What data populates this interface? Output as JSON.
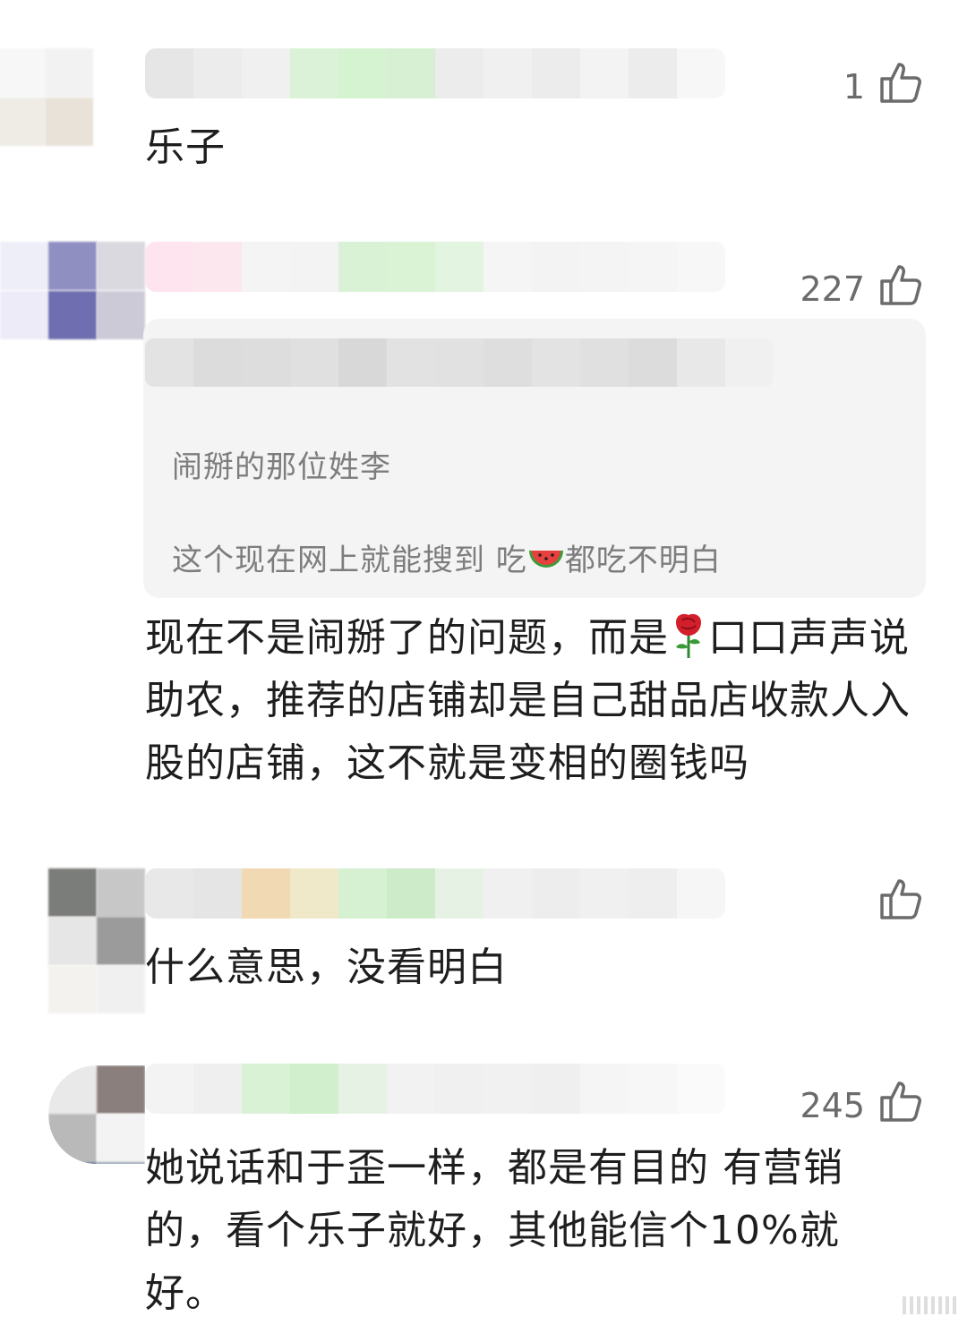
{
  "comments": [
    {
      "likes": "1",
      "text": "乐子",
      "avatar_colors": [
        "#f7f7f7",
        "#f2f2f2",
        "#efece6",
        "#e8e2d8"
      ],
      "name_colors": [
        "#e6e6e6",
        "#ececec",
        "#f0f0f0",
        "#dbf2d8",
        "#d5f3d1",
        "#d7f0d4",
        "#ececec",
        "#f0f0f0",
        "#ececec",
        "#f3f3f3",
        "#ececec",
        "#f7f7f7"
      ]
    },
    {
      "likes": "227",
      "quote": {
        "line1": "闹掰的那位姓李",
        "line2_before": "这个现在网上就能搜到 吃",
        "line2_after": "都吃不明白"
      },
      "text_before": "现在不是闹掰了的问题，而是",
      "text_after": "口口声声说助农，推荐的店铺却是自己甜品店收款人入股的店铺，这不就是变相的圈钱吗",
      "avatar_colors": [
        "#eeeef8",
        "#8f8fc2",
        "#d9d9df",
        "#ecebf7",
        "#6e6eb0",
        "#cccad6"
      ],
      "name_colors": [
        "#fde4ee",
        "#fce7ef",
        "#f4f4f4",
        "#f3f3f3",
        "#d9f2d6",
        "#d9f3d4",
        "#e3f4e0",
        "#f5f5f5",
        "#f3f3f3",
        "#f4f4f4",
        "#f5f5f5",
        "#f7f7f7"
      ],
      "quote_name_colors": [
        "#e3e3e3",
        "#dcdcdc",
        "#dddddd",
        "#e0e0e0",
        "#d8d8d8",
        "#e2e2e2",
        "#e1e1e1",
        "#dedede",
        "#e3e3e3",
        "#e0e0e0",
        "#dcdcdc",
        "#e8e8e8",
        "#f0f0f0"
      ]
    },
    {
      "likes": "",
      "text": "什么意思，没看明白",
      "avatar_colors": [
        "#7b7d7a",
        "#c7c7c7",
        "#e6e6e6",
        "#9b9b9b",
        "#f3f2ef",
        "#f0f0f0"
      ],
      "name_colors": [
        "#e8e8e8",
        "#e5e5e5",
        "#f0d9b3",
        "#efe9c9",
        "#d6f0d2",
        "#cdebc8",
        "#e6f3e4",
        "#f0f0f0",
        "#ededed",
        "#f0f0f0",
        "#eeeeee",
        "#f6f6f6"
      ]
    },
    {
      "likes": "245",
      "text": "她说话和于歪一样，都是有目的 有营销的，看个乐子就好，其他能信个10%就好。",
      "avatar_colors": [
        "#e9e9e9",
        "#8a7f7c",
        "#b9b9b9",
        "#f3f3f3",
        "#5e6f86",
        "#9da7b5"
      ],
      "name_colors": [
        "#f3f3f3",
        "#efefef",
        "#d9f2d6",
        "#d1efcc",
        "#e6f3e4",
        "#f2f2f2",
        "#f0f0f0",
        "#f1f1f1",
        "#efefef",
        "#f5f5f5",
        "#f7f7f7",
        "#fafafa"
      ]
    }
  ]
}
